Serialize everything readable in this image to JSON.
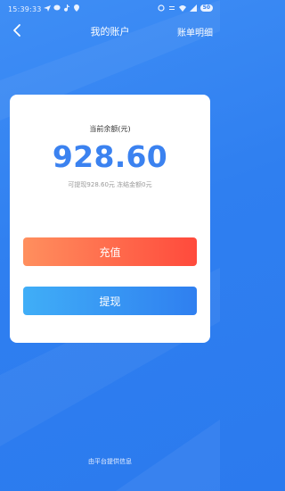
{
  "status_bar": {
    "time": "15:39:33",
    "battery": "50"
  },
  "header": {
    "title": "我的账户",
    "right_link": "账单明细"
  },
  "account": {
    "balance_label": "当前余额(元)",
    "balance": "928.60",
    "detail": "可提现928.60元 冻结金额0元"
  },
  "actions": {
    "recharge": "充值",
    "withdraw": "提现"
  },
  "footer": "由平台提供信息",
  "colors": {
    "background": "#2f7ff0",
    "amount": "#3b82f0",
    "recharge_start": "#ff8f5e",
    "recharge_end": "#ff4a3c",
    "withdraw_start": "#40aef7"
  }
}
